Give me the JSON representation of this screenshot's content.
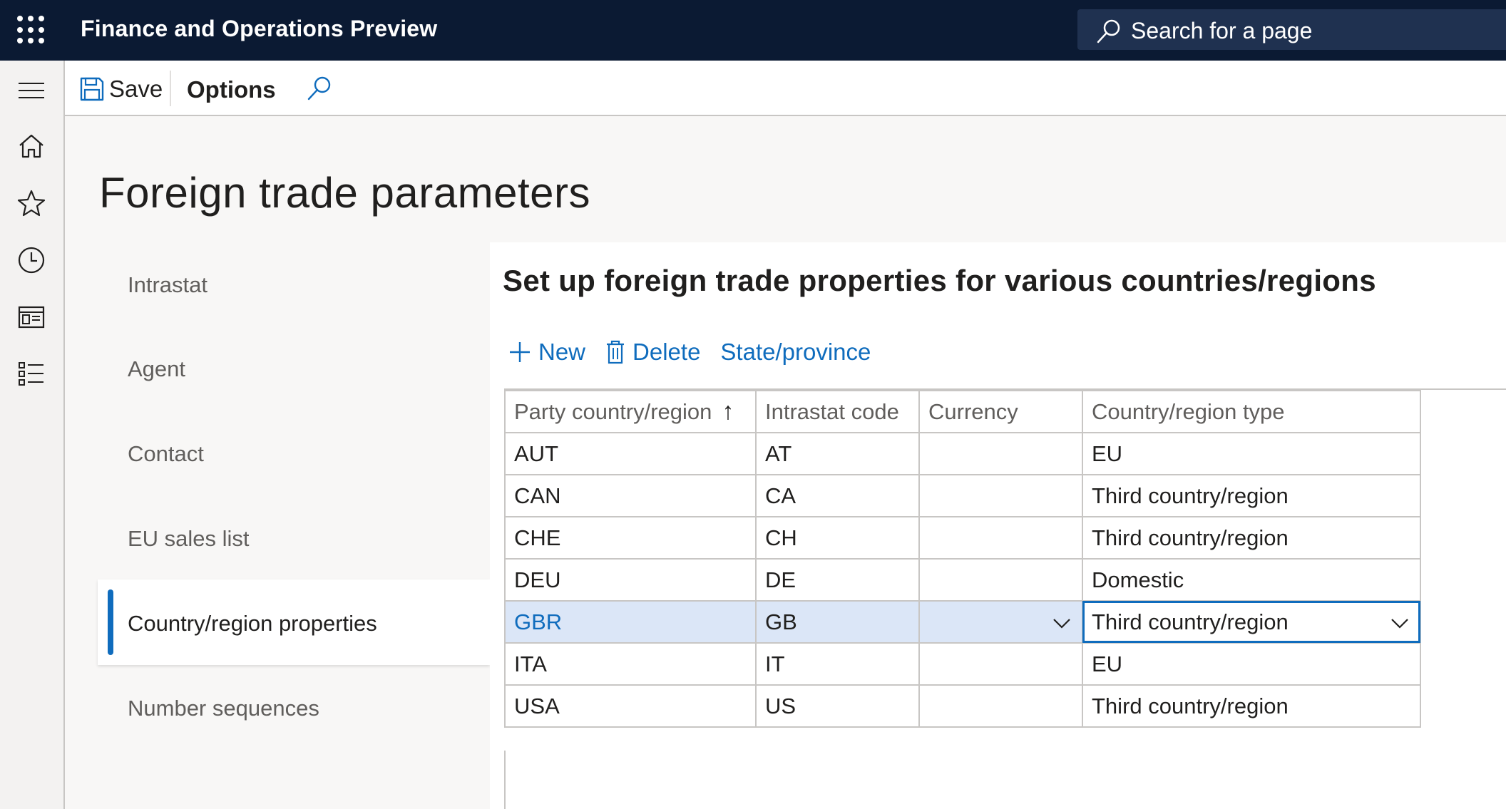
{
  "topbar": {
    "app_title": "Finance and Operations Preview",
    "search_placeholder": "Search for a page"
  },
  "actionbar": {
    "save_label": "Save",
    "options_label": "Options"
  },
  "page": {
    "title": "Foreign trade parameters"
  },
  "subnav": {
    "items": [
      {
        "label": "Intrastat"
      },
      {
        "label": "Agent"
      },
      {
        "label": "Contact"
      },
      {
        "label": "EU sales list"
      },
      {
        "label": "Country/region properties",
        "active": true
      },
      {
        "label": "Number sequences"
      }
    ]
  },
  "panel": {
    "title": "Set up foreign trade properties for various countries/regions",
    "actions": {
      "new_label": "New",
      "delete_label": "Delete",
      "state_label": "State/province"
    }
  },
  "grid": {
    "headers": [
      "Party country/region",
      "Intrastat code",
      "Currency",
      "Country/region type"
    ],
    "sort_indicator": "↑",
    "rows": [
      {
        "party": "AUT",
        "code": "AT",
        "currency": "",
        "type": "EU"
      },
      {
        "party": "CAN",
        "code": "CA",
        "currency": "",
        "type": "Third country/region"
      },
      {
        "party": "CHE",
        "code": "CH",
        "currency": "",
        "type": "Third country/region"
      },
      {
        "party": "DEU",
        "code": "DE",
        "currency": "",
        "type": "Domestic"
      },
      {
        "party": "GBR",
        "code": "GB",
        "currency": "",
        "type": "Third country/region",
        "selected": true
      },
      {
        "party": "ITA",
        "code": "IT",
        "currency": "",
        "type": "EU"
      },
      {
        "party": "USA",
        "code": "US",
        "currency": "",
        "type": "Third country/region"
      }
    ]
  },
  "colors": {
    "topbar_bg": "#0b1a33",
    "accent": "#0f6cbd",
    "selected_row": "#dbe6f7"
  },
  "icons": [
    "app-launcher-icon",
    "search-icon",
    "hamburger-icon",
    "home-icon",
    "star-icon",
    "clock-icon",
    "workspace-icon",
    "modules-list-icon",
    "save-icon",
    "find-icon",
    "plus-icon",
    "trash-icon",
    "chevron-down-icon"
  ]
}
